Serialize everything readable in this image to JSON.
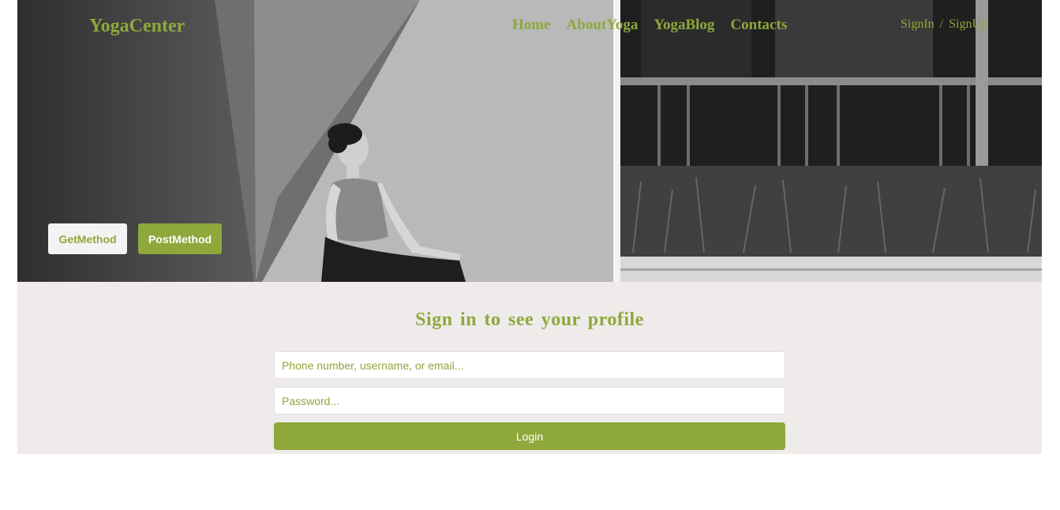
{
  "header": {
    "logo": "YogaCenter",
    "nav": [
      {
        "label": "Home"
      },
      {
        "label": "AboutYoga"
      },
      {
        "label": "YogaBlog"
      },
      {
        "label": "Contacts"
      }
    ],
    "auth": {
      "signin": "SignIn",
      "separator": "/",
      "signup": "SignUp"
    }
  },
  "hero": {
    "get_button": "GetMethod",
    "post_button": "PostMethod"
  },
  "signin": {
    "title": "Sign in to see your profile",
    "username_placeholder": "Phone number, username, or email...",
    "username_value": "",
    "password_placeholder": "Password...",
    "password_value": "",
    "login_label": "Login"
  },
  "colors": {
    "accent": "#8ea83c",
    "panel_background": "#eeebea",
    "button_light": "#f3f3f3",
    "text_on_accent": "#ffffff"
  }
}
